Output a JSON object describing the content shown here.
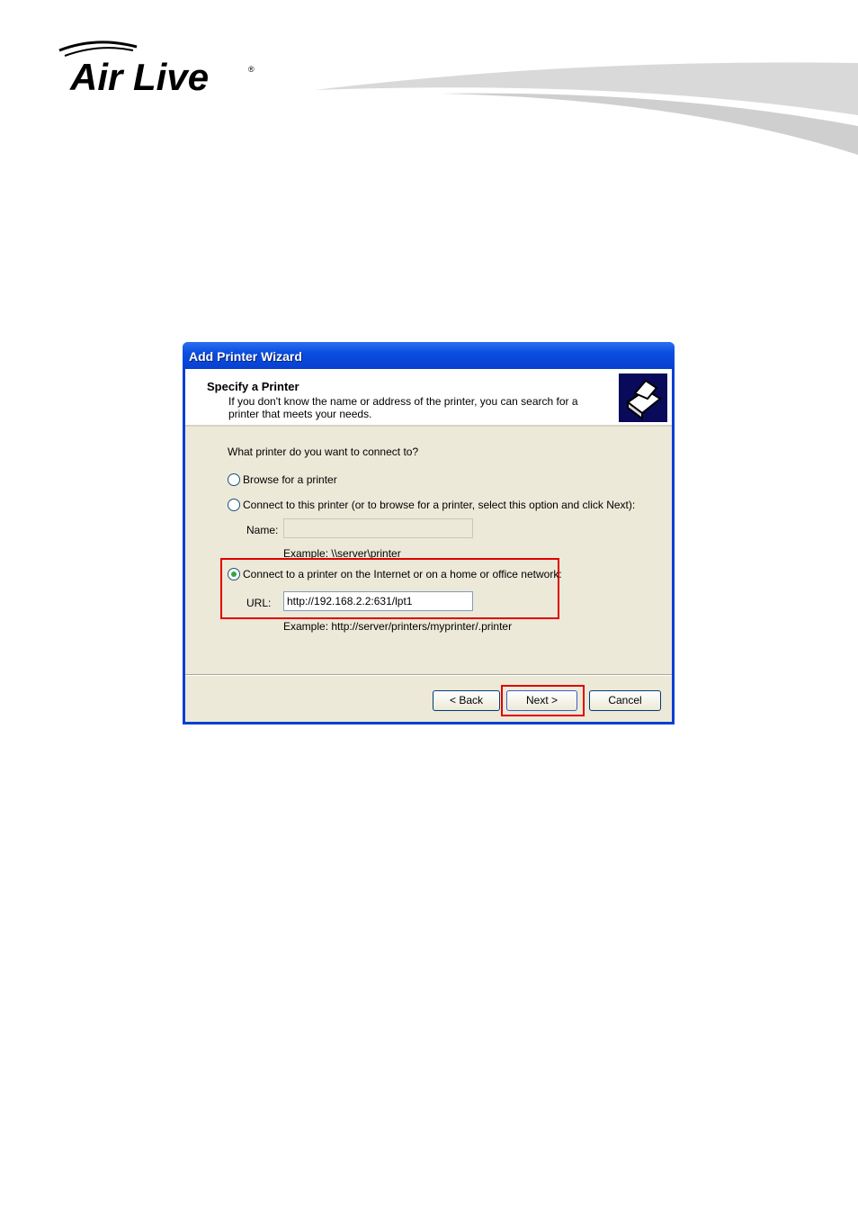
{
  "header": {
    "logo_text": "Air Live"
  },
  "dialog": {
    "title": "Add Printer Wizard",
    "heading": "Specify a Printer",
    "subheading": "If you don't know the name or address of the printer, you can search for a printer that meets your needs.",
    "question": "What printer do you want to connect to?",
    "options": [
      {
        "label": "Browse for a printer",
        "selected": false
      },
      {
        "label": "Connect to this printer (or to browse for a printer, select this option and click Next):",
        "selected": false
      },
      {
        "label": "Connect to a printer on the Internet or on a home or office network:",
        "selected": true
      }
    ],
    "name_label": "Name:",
    "name_value": "",
    "name_example": "Example: \\\\server\\printer",
    "url_label": "URL:",
    "url_value": "http://192.168.2.2:631/lpt1",
    "url_example": "Example: http://server/printers/myprinter/.printer",
    "buttons": {
      "back": "< Back",
      "next": "Next >",
      "cancel": "Cancel"
    }
  },
  "colors": {
    "highlight": "#e00000",
    "titlebar": "#0a4ee0",
    "dialog_bg": "#ece9d8"
  }
}
